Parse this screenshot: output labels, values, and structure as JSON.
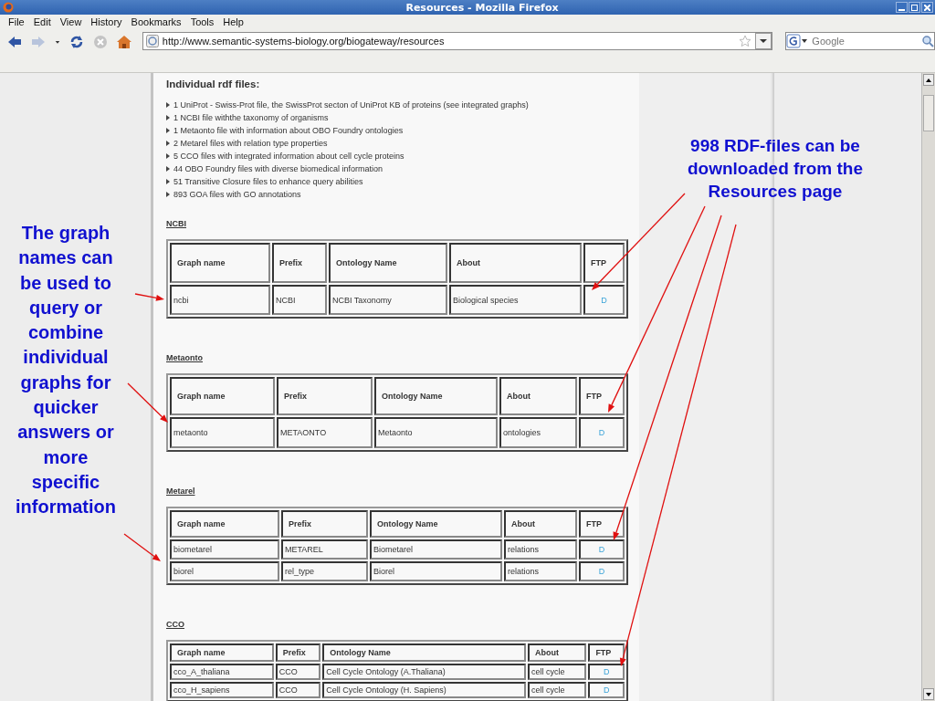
{
  "window": {
    "title": "Resources - Mozilla Firefox"
  },
  "menu": [
    "File",
    "Edit",
    "View",
    "History",
    "Bookmarks",
    "Tools",
    "Help"
  ],
  "toolbar": {
    "url": "http://www.semantic-systems-biology.org/biogateway/resources",
    "search_placeholder": "Google"
  },
  "page": {
    "heading": "Individual rdf files:",
    "bullets": [
      "1 UniProt - Swiss-Prot file, the SwissProt secton of UniProt KB of proteins (see integrated graphs)",
      "1 NCBI file withthe taxonomy of organisms",
      "1 Metaonto file with information about OBO Foundry ontologies",
      "2 Metarel files with relation type properties",
      "5 CCO files with integrated information about cell cycle proteins",
      "44 OBO Foundry files with diverse biomedical information",
      "51 Transitive Closure files to enhance query abilities",
      "893 GOA files with GO annotations"
    ],
    "sections": [
      {
        "title": "NCBI",
        "columns": [
          "Graph name",
          "Prefix",
          "Ontology Name",
          "About",
          "FTP"
        ],
        "rows": [
          [
            "ncbi",
            "NCBI",
            "NCBI Taxonomy",
            "Biological species",
            "D"
          ]
        ]
      },
      {
        "title": "Metaonto",
        "columns": [
          "Graph name",
          "Prefix",
          "Ontology Name",
          "About",
          "FTP"
        ],
        "rows": [
          [
            "metaonto",
            "METAONTO",
            "Metaonto",
            "ontologies",
            "D"
          ]
        ]
      },
      {
        "title": "Metarel",
        "columns": [
          "Graph name",
          "Prefix",
          "Ontology Name",
          "About",
          "FTP"
        ],
        "rows": [
          [
            "biometarel",
            "METAREL",
            "Biometarel",
            "relations",
            "D"
          ],
          [
            "biorel",
            "rel_type",
            "Biorel",
            "relations",
            "D"
          ]
        ]
      },
      {
        "title": "CCO",
        "columns": [
          "Graph name",
          "Prefix",
          "Ontology Name",
          "About",
          "FTP"
        ],
        "rows": [
          [
            "cco_A_thaliana",
            "CCO",
            "Cell Cycle Ontology (A.Thaliana)",
            "cell cycle",
            "D"
          ],
          [
            "cco_H_sapiens",
            "CCO",
            "Cell Cycle Ontology (H. Sapiens)",
            "cell cycle",
            "D"
          ]
        ]
      }
    ]
  },
  "annotations": [
    {
      "text": "The graph names can be used to query or combine individual graphs for quicker answers or more specific information"
    },
    {
      "text": "998 RDF-files can be downloaded from the Resources page"
    }
  ]
}
